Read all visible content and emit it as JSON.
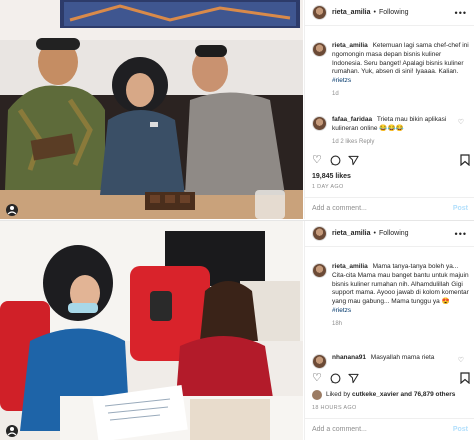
{
  "posts": [
    {
      "header": {
        "username": "rieta_amilia",
        "separator": "•",
        "follow": "Following",
        "more": "•••"
      },
      "caption": {
        "username": "rieta_amilia",
        "text": "Ketemuan lagi sama chef-chef ini ngomongin masa depan bisnis kuliner Indonesia. Seru banget! Apalagi bisnis kuliner rumahan. Yuk, absen di sini! Iyaaaa. Kalian.",
        "hashtag": "#rietzs",
        "time": "1d"
      },
      "comment": {
        "username": "fafaa_faridaa",
        "text": "Trieta mau bikin aplikasi kulineran online",
        "emoji": "😂😂😂",
        "meta": "1d   2 likes   Reply"
      },
      "likes": "19,845 likes",
      "ago": "1 DAY AGO",
      "add_comment": "Add a comment...",
      "post_label": "Post"
    },
    {
      "header": {
        "username": "rieta_amilia",
        "separator": "•",
        "follow": "Following",
        "more": "•••"
      },
      "caption": {
        "username": "rieta_amilia",
        "text": "Mama tanya-tanya boleh ya... Cita-cita Mama mau banget bantu untuk majuin bisnis kuliner rumahan nih. Alhamdulillah Gigi support mama. Ayooo jawab di kolom komentar yang mau gabung... Mama tunggu ya 😍",
        "hashtag": "#rietzs",
        "time": "18h"
      },
      "comment": {
        "username": "nhanana91",
        "text": "Masyallah mama rieta",
        "emoji": "",
        "meta": ""
      },
      "liked_by": "Liked by",
      "liked_user": "cutkeke_xavier",
      "liked_rest": "and 76,879 others",
      "ago": "18 HOURS AGO",
      "add_comment": "Add a comment...",
      "post_label": "Post"
    }
  ],
  "icons": [
    "heart-icon",
    "comment-icon",
    "share-icon",
    "bookmark-icon",
    "more-icon"
  ]
}
